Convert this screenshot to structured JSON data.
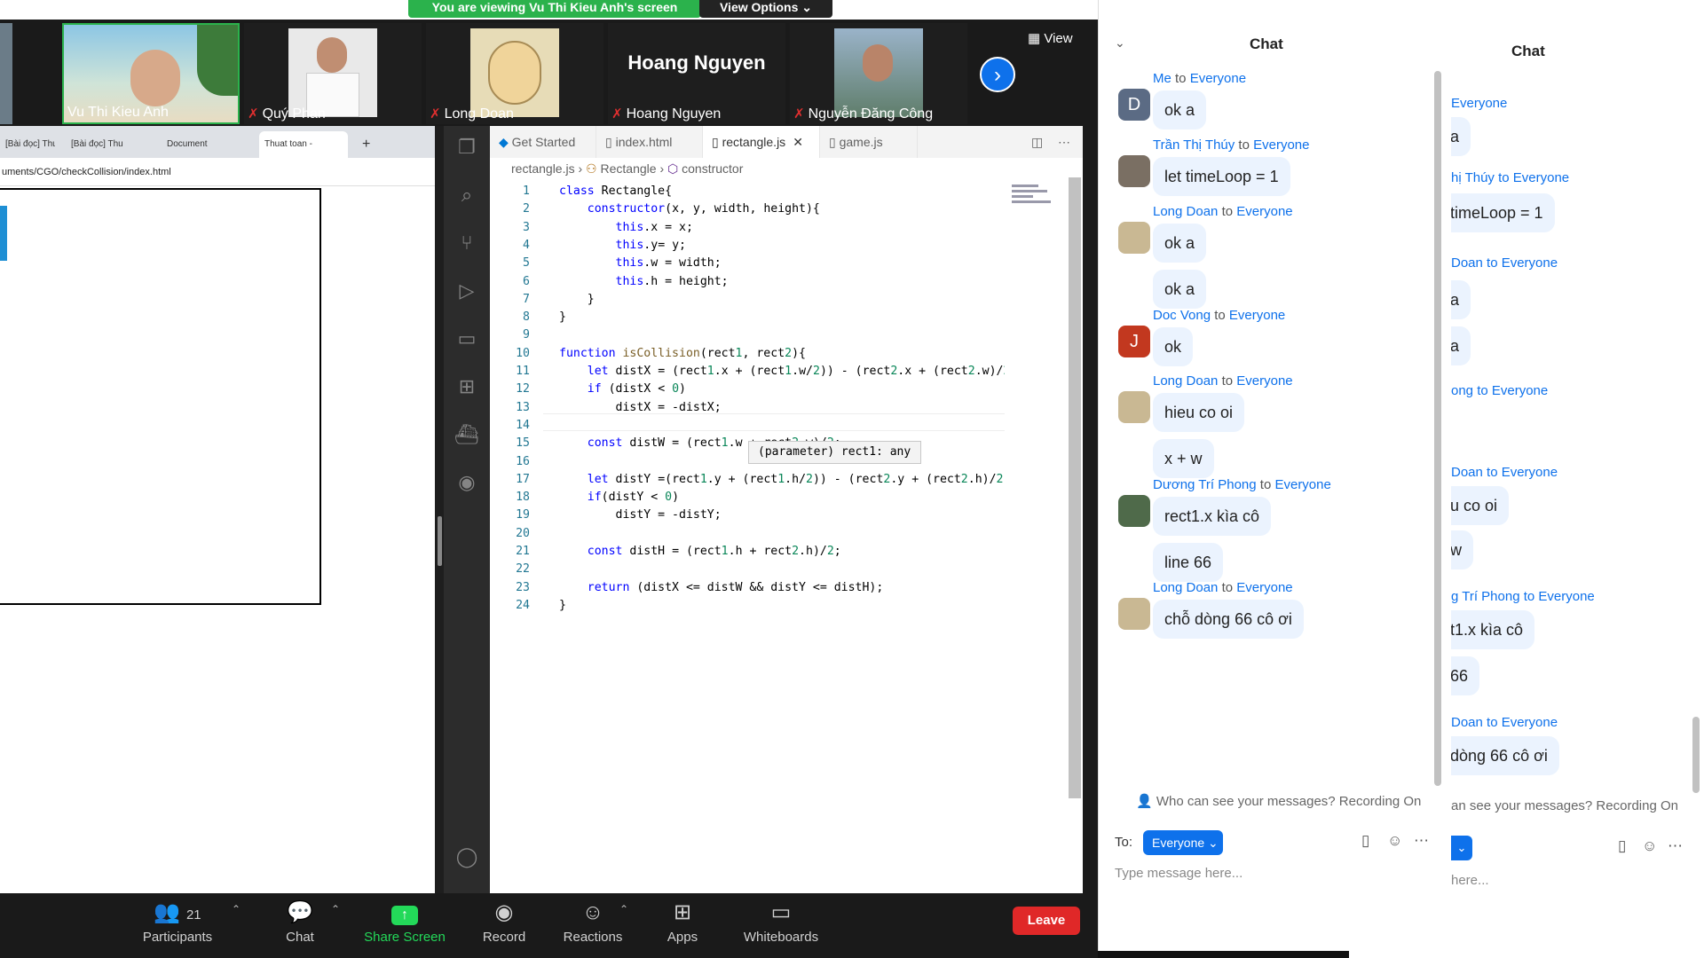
{
  "banner": {
    "viewing": "You are viewing Vu Thi Kieu Anh's screen",
    "view_options": "View Options ⌄"
  },
  "window_controls": {
    "minimize": "—",
    "restore": "❐",
    "close": "✕"
  },
  "thumbnails": [
    {
      "name": "Vu Thi Kieu Anh",
      "muted": false
    },
    {
      "name": "Quý Phan",
      "muted": true
    },
    {
      "name": "Long Doan",
      "muted": true
    },
    {
      "name": "Hoang Nguyen",
      "muted": true
    },
    {
      "name": "Nguyễn Đăng Công",
      "muted": true
    }
  ],
  "center_name": "Hoang Nguyen",
  "view_button": "View",
  "chrome": {
    "tabs": [
      "[Bài đọc] Thu",
      "[Bài đọc] Thu",
      "Document",
      "Thuat toan -"
    ],
    "address": "uments/CGO/checkCollision/index.html"
  },
  "vscode": {
    "tabs": [
      "Get Started",
      "index.html",
      "rectangle.js",
      "game.js"
    ],
    "breadcrumb": {
      "file": "rectangle.js",
      "class": "Rectangle",
      "member": "constructor"
    },
    "hover_tip": "(parameter) rect1: any",
    "lines": [
      "class Rectangle{",
      "    constructor(x, y, width, height){",
      "        this.x = x;",
      "        this.y= y;",
      "        this.w = width;",
      "        this.h = height;",
      "    }",
      "}",
      "",
      "function isCollision(rect1, rect2){",
      "    let distX = (rect1.x + (rect1.w/2)) - (rect2.x + (rect2.w)/2",
      "    if (distX < 0)",
      "        distX = -distX;",
      "",
      "    const distW = (rect1.w + rect2.w)/2;",
      "",
      "    let distY =(rect1.y + (rect1.h/2)) - (rect2.y + (rect2.h)/2)",
      "    if(distY < 0)",
      "        distY = -distY;",
      "",
      "    const distH = (rect1.h + rect2.h)/2;",
      "",
      "    return (distX <= distW && distY <= distH);",
      "}"
    ]
  },
  "toolbar": {
    "participants_count": "21",
    "participants": "Participants",
    "chat": "Chat",
    "share_screen": "Share Screen",
    "record": "Record",
    "reactions": "Reactions",
    "apps": "Apps",
    "whiteboards": "Whiteboards",
    "leave": "Leave"
  },
  "chat": {
    "title": "Chat",
    "messages": [
      {
        "sender": "Me",
        "to": "Everyone",
        "avatar_letter": "D",
        "avatar_color": "#5b6b84",
        "texts": [
          "ok a"
        ]
      },
      {
        "sender": "Trần Thị Thúy",
        "to": "Everyone",
        "avatar_letter": "",
        "avatar_color": "#7a6f63",
        "texts": [
          "let timeLoop = 1"
        ]
      },
      {
        "sender": "Long Doan",
        "to": "Everyone",
        "avatar_letter": "",
        "avatar_color": "#c9b893",
        "texts": [
          "ok a",
          "ok a"
        ]
      },
      {
        "sender": "Doc Vong",
        "to": "Everyone",
        "avatar_letter": "J",
        "avatar_color": "#c2381f",
        "texts": [
          "ok"
        ]
      },
      {
        "sender": "Long Doan",
        "to": "Everyone",
        "avatar_letter": "",
        "avatar_color": "#c9b893",
        "texts": [
          "hieu co oi",
          "x + w"
        ]
      },
      {
        "sender": "Dương Trí Phong",
        "to": "Everyone",
        "avatar_letter": "",
        "avatar_color": "#4f6a4a",
        "texts": [
          "rect1.x kìa cô",
          "line 66"
        ]
      },
      {
        "sender": "Long Doan",
        "to": "Everyone",
        "avatar_letter": "",
        "avatar_color": "#c9b893",
        "texts": [
          "chỗ dòng 66 cô ơi"
        ]
      }
    ],
    "to_word": "to",
    "privacy_note": "Who can see your messages? Recording On",
    "to_label": "To:",
    "to_value": "Everyone",
    "input_placeholder": "Type message here..."
  },
  "chat2": {
    "title": "Chat",
    "snippets": [
      {
        "sender": "Everyone",
        "text": "a"
      },
      {
        "sender": "hị Thúy to Everyone",
        "text": "timeLoop = 1"
      },
      {
        "sender": "Doan to Everyone",
        "text": "a"
      },
      {
        "sender": "",
        "text": "a"
      },
      {
        "sender": "ong to Everyone",
        "text": ""
      },
      {
        "sender": "Doan to Everyone",
        "text": "u co oi"
      },
      {
        "sender": "",
        "text": "w"
      },
      {
        "sender": "g Trí Phong to Everyone",
        "text": "t1.x kìa cô"
      },
      {
        "sender": "",
        "text": "66"
      },
      {
        "sender": "Doan to Everyone",
        "text": "dòng 66 cô ơi"
      }
    ],
    "privacy_note": "an see your messages? Recording On",
    "input_placeholder": "here..."
  },
  "colors": {
    "zoom_blue": "#0e71eb",
    "share_green": "#23d959",
    "banner_green": "#2bb24c",
    "leave_red": "#e02828"
  }
}
